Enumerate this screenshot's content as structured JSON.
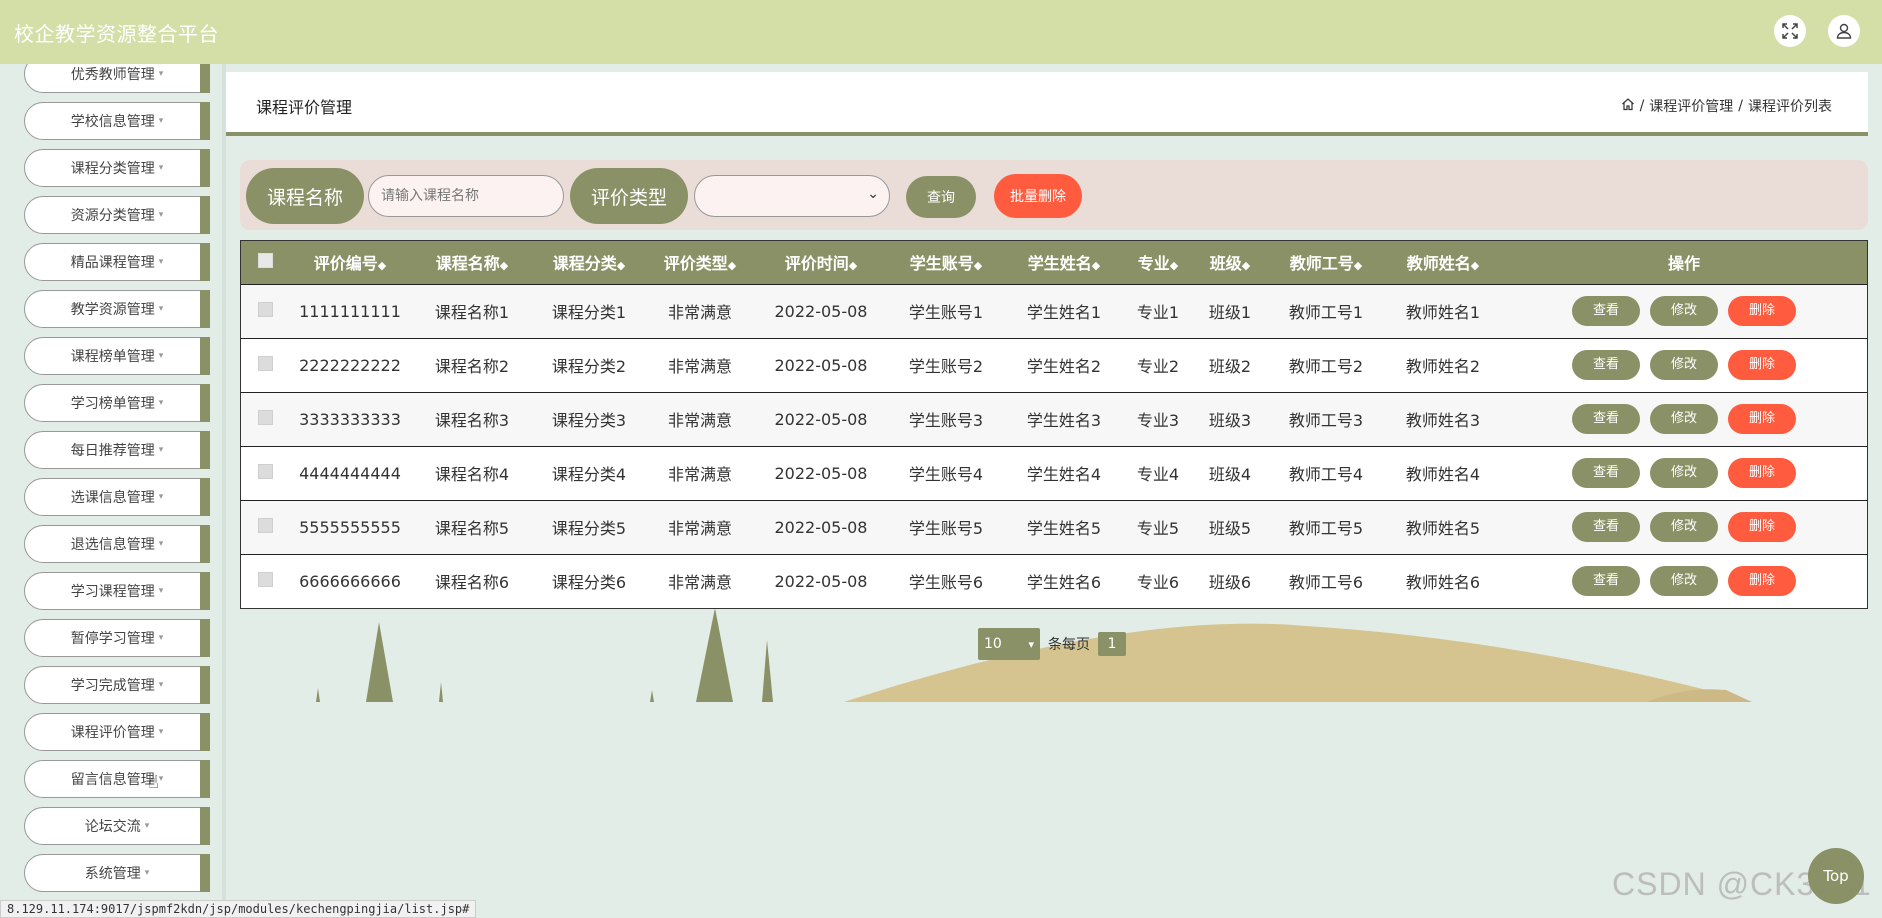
{
  "app": {
    "title": "校企教学资源整合平台"
  },
  "topbar": {
    "fullscreen_icon": "expand-icon",
    "user_icon": "user-icon"
  },
  "colors": {
    "topbar": "#d3dfa7",
    "accent": "#8b9166",
    "danger": "#ff5b3f",
    "background": "#e3ede7",
    "search_panel": "#eadcd6"
  },
  "sidebar": {
    "items": [
      {
        "label": "优秀教师管理"
      },
      {
        "label": "学校信息管理"
      },
      {
        "label": "课程分类管理"
      },
      {
        "label": "资源分类管理"
      },
      {
        "label": "精品课程管理"
      },
      {
        "label": "教学资源管理"
      },
      {
        "label": "课程榜单管理"
      },
      {
        "label": "学习榜单管理"
      },
      {
        "label": "每日推荐管理"
      },
      {
        "label": "选课信息管理"
      },
      {
        "label": "退选信息管理"
      },
      {
        "label": "学习课程管理"
      },
      {
        "label": "暂停学习管理"
      },
      {
        "label": "学习完成管理"
      },
      {
        "label": "课程评价管理"
      },
      {
        "label": "留言信息管理"
      },
      {
        "label": "论坛交流"
      },
      {
        "label": "系统管理"
      }
    ]
  },
  "header": {
    "title": "课程评价管理",
    "breadcrumb": {
      "home_icon": "home-icon",
      "sep": "/",
      "level1": "课程评价管理",
      "level2": "课程评价列表"
    }
  },
  "search": {
    "course_label": "课程名称",
    "course_placeholder": "请输入课程名称",
    "course_value": "",
    "type_label": "评价类型",
    "type_selected": "",
    "query_button": "查询",
    "batch_delete_button": "批量删除"
  },
  "table": {
    "columns": [
      "评价编号",
      "课程名称",
      "课程分类",
      "评价类型",
      "评价时间",
      "学生账号",
      "学生姓名",
      "专业",
      "班级",
      "教师工号",
      "教师姓名"
    ],
    "sort_glyph": "◆",
    "ops_header": "操作",
    "op_labels": {
      "view": "查看",
      "edit": "修改",
      "delete": "删除"
    },
    "rows": [
      [
        "1111111111",
        "课程名称1",
        "课程分类1",
        "非常满意",
        "2022-05-08",
        "学生账号1",
        "学生姓名1",
        "专业1",
        "班级1",
        "教师工号1",
        "教师姓名1"
      ],
      [
        "2222222222",
        "课程名称2",
        "课程分类2",
        "非常满意",
        "2022-05-08",
        "学生账号2",
        "学生姓名2",
        "专业2",
        "班级2",
        "教师工号2",
        "教师姓名2"
      ],
      [
        "3333333333",
        "课程名称3",
        "课程分类3",
        "非常满意",
        "2022-05-08",
        "学生账号3",
        "学生姓名3",
        "专业3",
        "班级3",
        "教师工号3",
        "教师姓名3"
      ],
      [
        "4444444444",
        "课程名称4",
        "课程分类4",
        "非常满意",
        "2022-05-08",
        "学生账号4",
        "学生姓名4",
        "专业4",
        "班级4",
        "教师工号4",
        "教师姓名4"
      ],
      [
        "5555555555",
        "课程名称5",
        "课程分类5",
        "非常满意",
        "2022-05-08",
        "学生账号5",
        "学生姓名5",
        "专业5",
        "班级5",
        "教师工号5",
        "教师姓名5"
      ],
      [
        "6666666666",
        "课程名称6",
        "课程分类6",
        "非常满意",
        "2022-05-08",
        "学生账号6",
        "学生姓名6",
        "专业6",
        "班级6",
        "教师工号6",
        "教师姓名6"
      ]
    ]
  },
  "pagination": {
    "page_size": "10",
    "per_page_label": "条每页",
    "current_page": "1"
  },
  "status_url": "8.129.11.174:9017/jspmf2kdn/jsp/modules/kechengpingjia/list.jsp#",
  "top_button": "Top",
  "watermark": "CSDN @CK3041"
}
